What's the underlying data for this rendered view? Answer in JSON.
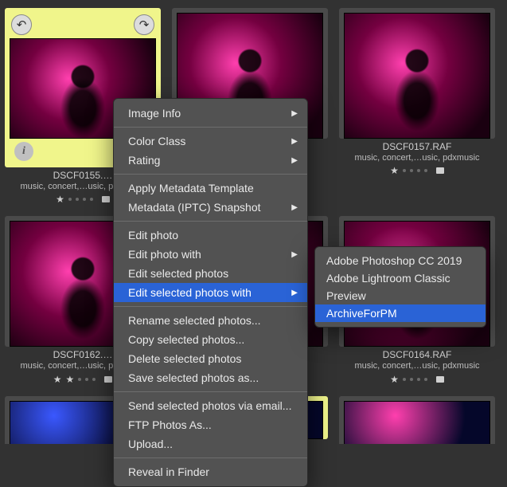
{
  "colors": {
    "highlight": "#2a63d6",
    "selection": "#f0f58b"
  },
  "grid": {
    "cells": [
      {
        "filename": "DSCF0155.…",
        "tags": "music, concert,…usic, pdxmusic",
        "stars": 1
      },
      {
        "filename": "",
        "tags": "",
        "stars": 0
      },
      {
        "filename": "DSCF0157.RAF",
        "tags": "music, concert,…usic, pdxmusic",
        "stars": 1
      },
      {
        "filename": "DSCF0162.…",
        "tags": "music, concert,…usic, pdxmusic",
        "stars": 2
      },
      {
        "filename": "",
        "tags": "",
        "stars": 0
      },
      {
        "filename": "DSCF0164.RAF",
        "tags": "music, concert,…usic, pdxmusic",
        "stars": 1
      }
    ]
  },
  "context_menu": {
    "image_info": "Image Info",
    "color_class": "Color Class",
    "rating": "Rating",
    "apply_metadata_template": "Apply Metadata Template",
    "metadata_snapshot": "Metadata (IPTC) Snapshot",
    "edit_photo": "Edit photo",
    "edit_photo_with": "Edit photo with",
    "edit_selected_photos": "Edit selected photos",
    "edit_selected_photos_with": "Edit selected photos with",
    "rename_selected": "Rename selected photos...",
    "copy_selected": "Copy selected photos...",
    "delete_selected": "Delete selected photos",
    "save_selected": "Save selected photos as...",
    "send_email": "Send selected photos via email...",
    "ftp_photos": "FTP Photos As...",
    "upload": "Upload...",
    "reveal_in_finder": "Reveal in Finder"
  },
  "submenu": {
    "items": [
      "Adobe Photoshop CC 2019",
      "Adobe Lightroom Classic",
      "Preview",
      "ArchiveForPM"
    ],
    "highlighted_index": 3
  }
}
